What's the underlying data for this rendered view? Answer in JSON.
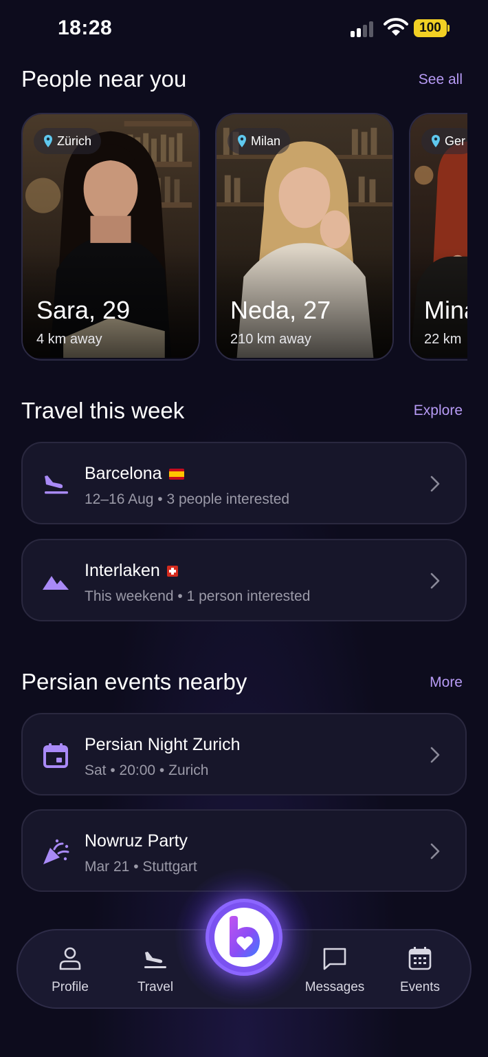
{
  "status_bar": {
    "time": "18:28",
    "battery": "100"
  },
  "people": {
    "title": "People near you",
    "link": "See all",
    "items": [
      {
        "location": "Zürich",
        "name": "Sara, 29",
        "distance": "4 km away"
      },
      {
        "location": "Milan",
        "name": "Neda, 27",
        "distance": "210 km away"
      },
      {
        "location": "Ger",
        "name": "Mina",
        "distance": "22 km"
      }
    ]
  },
  "travel": {
    "title": "Travel this week",
    "link": "Explore",
    "items": [
      {
        "title": "Barcelona",
        "subtitle": "12–16 Aug • 3 people interested",
        "icon": "airplane-landing-icon",
        "flag": "spain-flag"
      },
      {
        "title": "Interlaken",
        "subtitle": "This weekend • 1 person interested",
        "icon": "mountain-icon",
        "flag": "switzerland-flag"
      }
    ]
  },
  "events": {
    "title": "Persian events nearby",
    "link": "More",
    "items": [
      {
        "title": "Persian Night Zurich",
        "subtitle": "Sat • 20:00 • Zurich",
        "icon": "calendar-icon"
      },
      {
        "title": "Nowruz Party",
        "subtitle": "Mar 21 • Stuttgart",
        "icon": "party-popper-icon"
      }
    ]
  },
  "nav": {
    "items": [
      {
        "label": "Profile",
        "icon": "person-icon"
      },
      {
        "label": "Travel",
        "icon": "airplane-icon"
      },
      {
        "label": "Messages",
        "icon": "chat-icon"
      },
      {
        "label": "Events",
        "icon": "calendar-grid-icon"
      }
    ],
    "center": {
      "icon": "app-logo-icon"
    }
  },
  "colors": {
    "accent": "#b79bf5",
    "icon": "#a98af7",
    "background": "#0d0c1d",
    "card": "#17162a"
  }
}
